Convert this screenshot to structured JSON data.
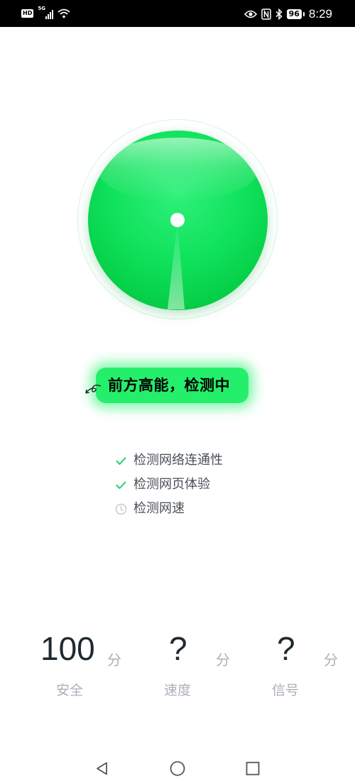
{
  "status_bar": {
    "hd_badge": "HD",
    "network_type": "5G",
    "battery_level": "96",
    "time": "8:29",
    "icons": [
      "hd-icon",
      "signal-icon",
      "wifi-icon",
      "eye-icon",
      "nfc-icon",
      "bluetooth-icon",
      "battery-icon"
    ]
  },
  "test_indicator": {
    "banner_text": "前方高能，检测中",
    "colors": {
      "ball": "#10e25c",
      "banner": "#24ef6a"
    }
  },
  "checklist": [
    {
      "label": "检测网络连通性",
      "status": "done",
      "icon": "check-icon"
    },
    {
      "label": "检测网页体验",
      "status": "done",
      "icon": "check-icon"
    },
    {
      "label": "检测网速",
      "status": "pending",
      "icon": "clock-icon"
    }
  ],
  "scores": [
    {
      "value": "100",
      "unit": "分",
      "label": "安全"
    },
    {
      "value": "?",
      "unit": "分",
      "label": "速度"
    },
    {
      "value": "?",
      "unit": "分",
      "label": "信号"
    }
  ],
  "nav_bar": {
    "buttons": [
      "back-icon",
      "home-icon",
      "recents-icon"
    ]
  },
  "theme": {
    "accent": "#1fd06f",
    "status_bar_bg": "#000000",
    "text_primary": "#1f2a30",
    "text_secondary": "#a9b0b8"
  }
}
